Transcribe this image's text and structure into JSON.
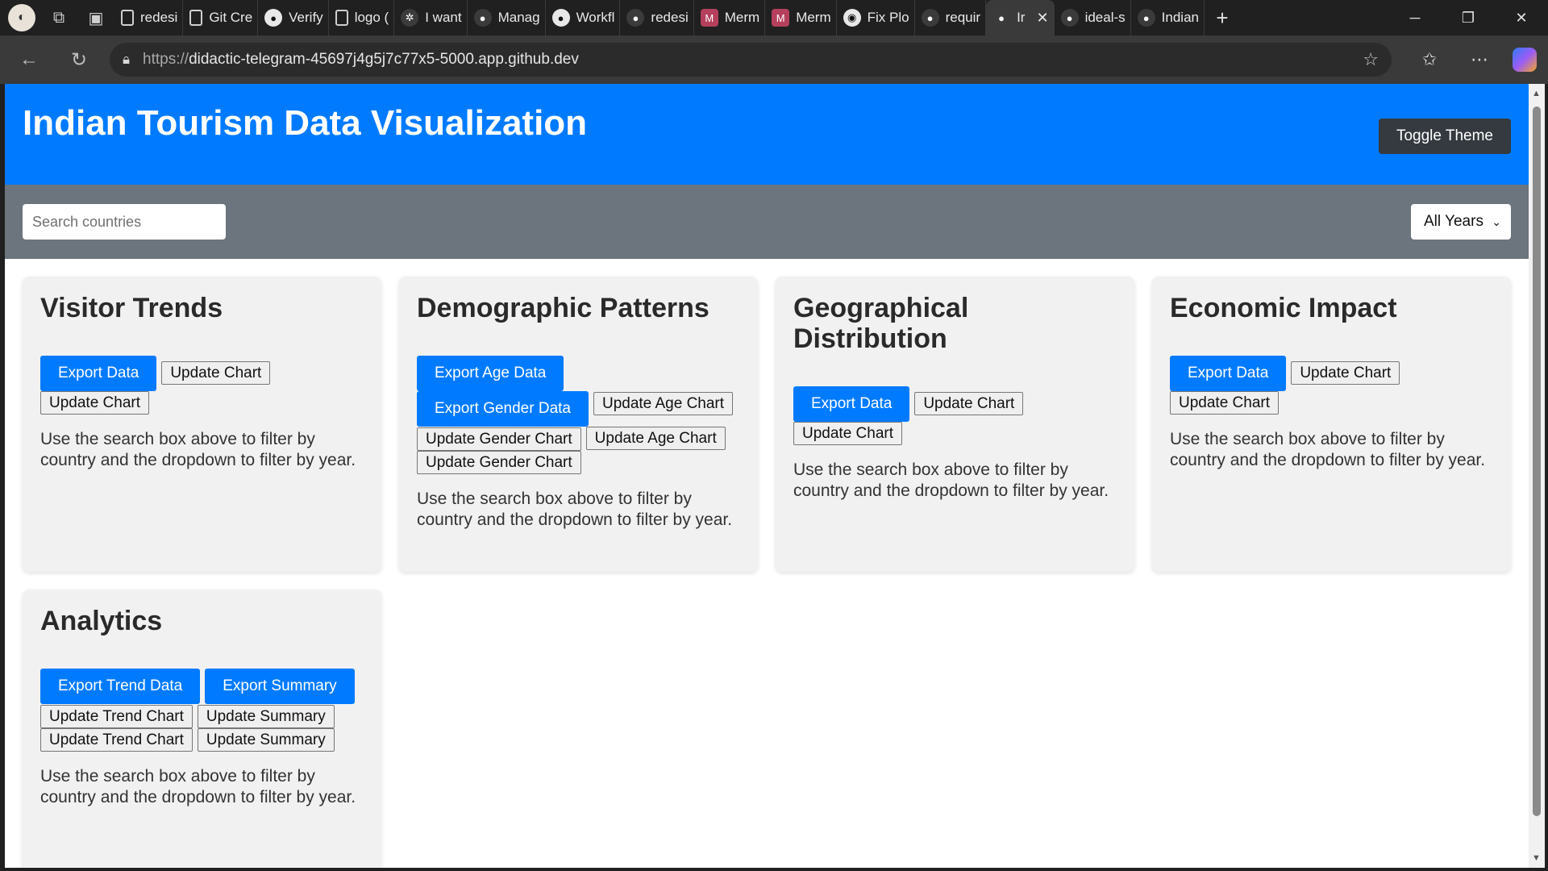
{
  "browser": {
    "tabs": [
      {
        "label": "redesi",
        "icon": "doc-icon"
      },
      {
        "label": "Git Cre",
        "icon": "doc-icon"
      },
      {
        "label": "Verify",
        "icon": "github-icon"
      },
      {
        "label": "logo (",
        "icon": "doc-icon"
      },
      {
        "label": "I want",
        "icon": "settings-icon"
      },
      {
        "label": "Manag",
        "icon": "github-icon"
      },
      {
        "label": "Workfl",
        "icon": "github-icon"
      },
      {
        "label": "redesi",
        "icon": "github-icon"
      },
      {
        "label": "Merm",
        "icon": "mermaid-icon"
      },
      {
        "label": "Merm",
        "icon": "mermaid-icon"
      },
      {
        "label": "Fix Plo",
        "icon": "copilot-icon"
      },
      {
        "label": "requir",
        "icon": "github-icon"
      },
      {
        "label": "Ir",
        "icon": "github-icon",
        "active": true
      },
      {
        "label": "ideal-s",
        "icon": "github-icon"
      },
      {
        "label": "Indian",
        "icon": "github-icon"
      }
    ],
    "url_scheme": "https://",
    "url_rest": "didactic-telegram-45697j4g5j7c77x5-5000.app.github.dev"
  },
  "header": {
    "title": "Indian Tourism Data Visualization",
    "toggle_label": "Toggle Theme"
  },
  "filters": {
    "search_placeholder": "Search countries",
    "year_selected": "All Years"
  },
  "help_text": "Use the search box above to filter by country and the dropdown to filter by year.",
  "cards": {
    "visitor": {
      "title": "Visitor Trends",
      "export": "Export Data",
      "update1": "Update Chart",
      "update2": "Update Chart"
    },
    "demographic": {
      "title": "Demographic Patterns",
      "export_age": "Export Age Data",
      "export_gender": "Export Gender Data",
      "update_age1": "Update Age Chart",
      "update_gender1": "Update Gender Chart",
      "update_age2": "Update Age Chart",
      "update_gender2": "Update Gender Chart"
    },
    "geo": {
      "title_line1": "Geographical",
      "title_line2": "Distribution",
      "export": "Export Data",
      "update1": "Update Chart",
      "update2": "Update Chart"
    },
    "economic": {
      "title": "Economic Impact",
      "export": "Export Data",
      "update1": "Update Chart",
      "update2": "Update Chart"
    },
    "analytics": {
      "title": "Analytics",
      "export_trend": "Export Trend Data",
      "export_summary": "Export Summary",
      "update_trend1": "Update Trend Chart",
      "update_summary1": "Update Summary",
      "update_trend2": "Update Trend Chart",
      "update_summary2": "Update Summary"
    }
  }
}
